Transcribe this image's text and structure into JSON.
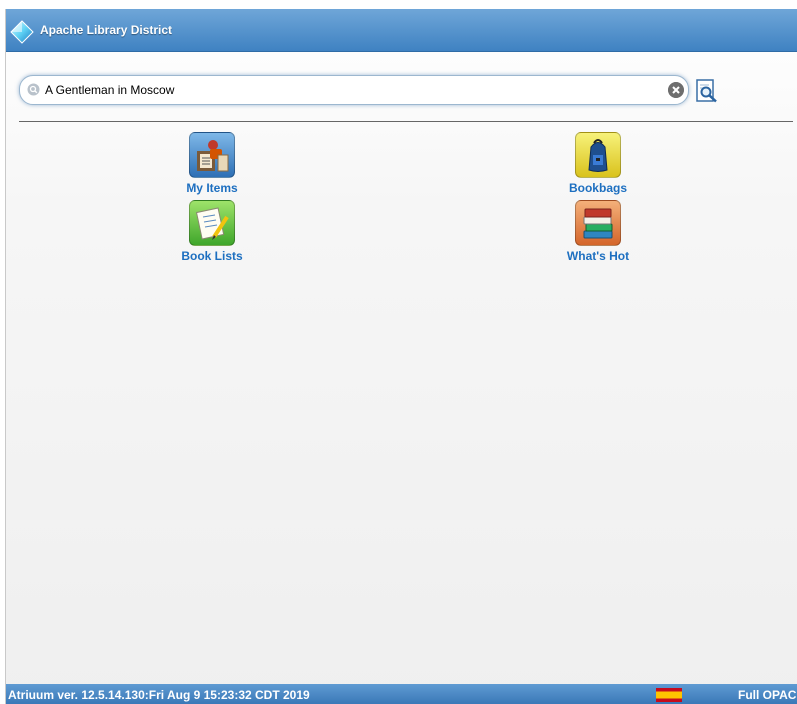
{
  "header": {
    "title": "Apache Library District"
  },
  "search": {
    "value": "A Gentleman in Moscow",
    "placeholder": ""
  },
  "tiles": [
    {
      "label": "My Items",
      "icon": "my-items-icon"
    },
    {
      "label": "Bookbags",
      "icon": "backpack-icon"
    },
    {
      "label": "Book Lists",
      "icon": "checklist-icon"
    },
    {
      "label": "What's Hot",
      "icon": "book-stack-icon"
    }
  ],
  "footer": {
    "version": "Atriuum ver. 12.5.14.130:Fri Aug 9 15:23:32 CDT 2019",
    "language_flag": "spain-flag-icon",
    "full_opac": "Full OPAC"
  },
  "colors": {
    "header_blue": "#3f82c2",
    "link_blue": "#1d6fc0",
    "background": "#efefef"
  }
}
